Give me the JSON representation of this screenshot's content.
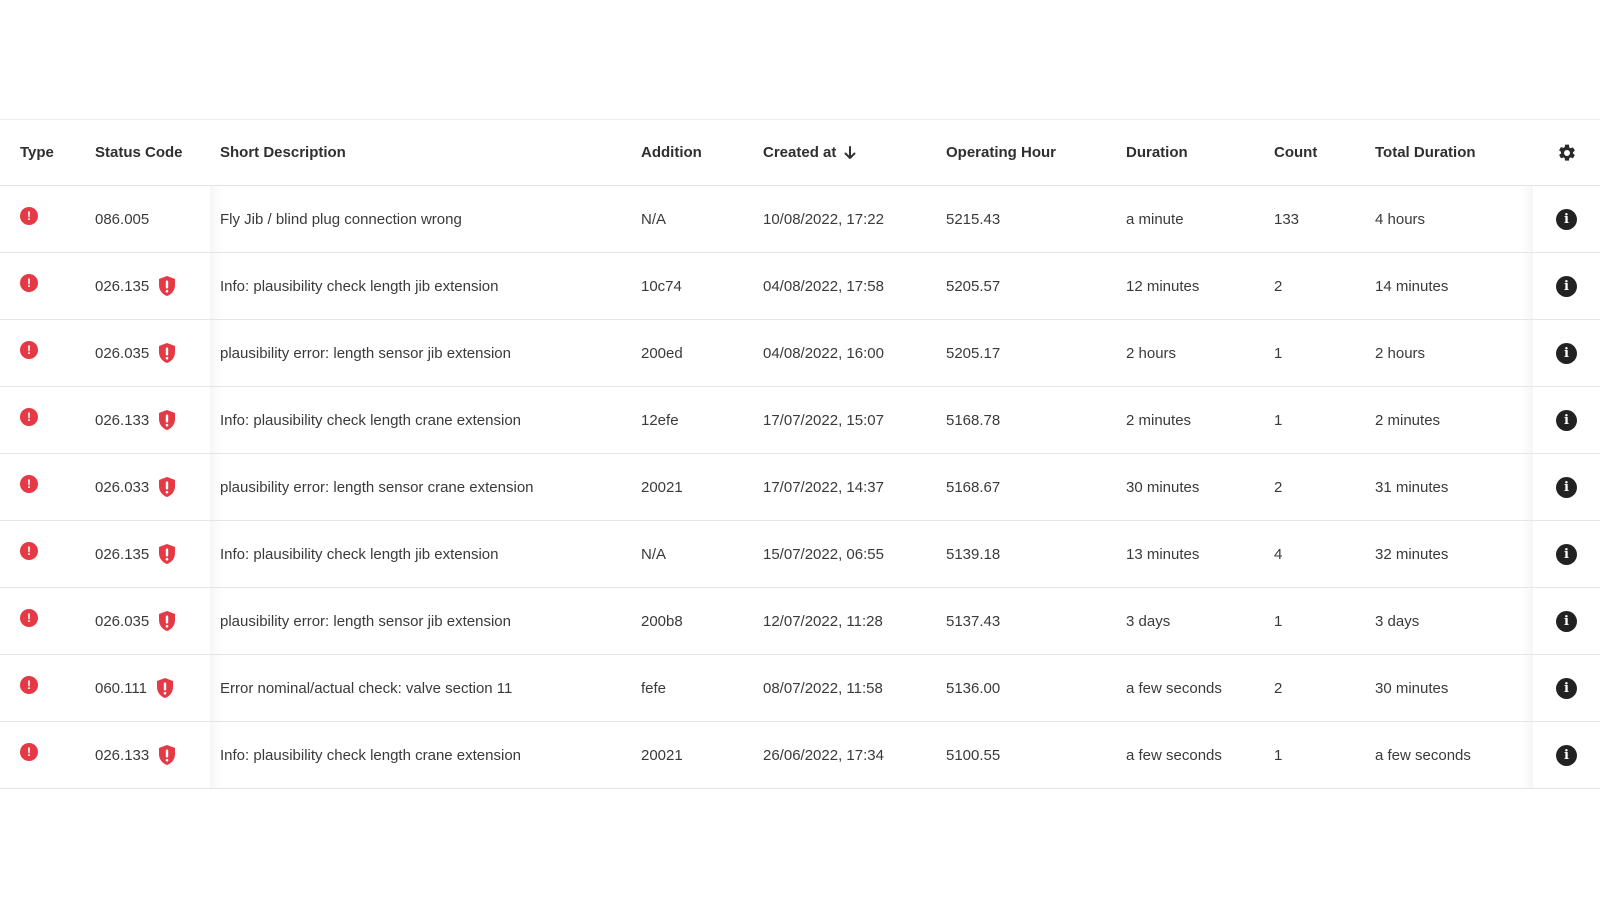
{
  "table": {
    "headers": {
      "type": "Type",
      "status_code": "Status Code",
      "short_description": "Short Description",
      "addition": "Addition",
      "created_at": "Created at",
      "operating_hour": "Operating Hour",
      "duration": "Duration",
      "count": "Count",
      "total_duration": "Total Duration"
    },
    "sort": {
      "column": "created_at",
      "direction": "descending",
      "icon": "arrow-down-icon"
    },
    "settings_icon": "gear-icon",
    "colors": {
      "error": "#e53946",
      "info_icon": "#222222",
      "text": "#3a3a3a"
    },
    "rows": [
      {
        "type_icon": "error-icon",
        "status_code": "086.005",
        "shield": false,
        "short_description": "Fly Jib / blind plug connection wrong",
        "addition": "N/A",
        "created_at": "10/08/2022, 17:22",
        "operating_hour": "5215.43",
        "duration": "a minute",
        "count": "133",
        "total_duration": "4 hours"
      },
      {
        "type_icon": "error-icon",
        "status_code": "026.135",
        "shield": true,
        "short_description": "Info: plausibility check length jib extension",
        "addition": "10c74",
        "created_at": "04/08/2022, 17:58",
        "operating_hour": "5205.57",
        "duration": "12 minutes",
        "count": "2",
        "total_duration": "14 minutes"
      },
      {
        "type_icon": "error-icon",
        "status_code": "026.035",
        "shield": true,
        "short_description": "plausibility error: length sensor jib extension",
        "addition": "200ed",
        "created_at": "04/08/2022, 16:00",
        "operating_hour": "5205.17",
        "duration": "2 hours",
        "count": "1",
        "total_duration": "2 hours"
      },
      {
        "type_icon": "error-icon",
        "status_code": "026.133",
        "shield": true,
        "short_description": "Info: plausibility check length crane extension",
        "addition": "12efe",
        "created_at": "17/07/2022, 15:07",
        "operating_hour": "5168.78",
        "duration": "2 minutes",
        "count": "1",
        "total_duration": "2 minutes"
      },
      {
        "type_icon": "error-icon",
        "status_code": "026.033",
        "shield": true,
        "short_description": "plausibility error: length sensor crane extension",
        "addition": "20021",
        "created_at": "17/07/2022, 14:37",
        "operating_hour": "5168.67",
        "duration": "30 minutes",
        "count": "2",
        "total_duration": "31 minutes"
      },
      {
        "type_icon": "error-icon",
        "status_code": "026.135",
        "shield": true,
        "short_description": "Info: plausibility check length jib extension",
        "addition": "N/A",
        "created_at": "15/07/2022, 06:55",
        "operating_hour": "5139.18",
        "duration": "13 minutes",
        "count": "4",
        "total_duration": "32 minutes"
      },
      {
        "type_icon": "error-icon",
        "status_code": "026.035",
        "shield": true,
        "short_description": "plausibility error: length sensor jib extension",
        "addition": "200b8",
        "created_at": "12/07/2022, 11:28",
        "operating_hour": "5137.43",
        "duration": "3 days",
        "count": "1",
        "total_duration": "3 days"
      },
      {
        "type_icon": "error-icon",
        "status_code": "060.111",
        "shield": true,
        "short_description": "Error nominal/actual check: valve section 11",
        "addition": "fefe",
        "created_at": "08/07/2022, 11:58",
        "operating_hour": "5136.00",
        "duration": "a few seconds",
        "count": "2",
        "total_duration": "30 minutes"
      },
      {
        "type_icon": "error-icon",
        "status_code": "026.133",
        "shield": true,
        "short_description": "Info: plausibility check length crane extension",
        "addition": "20021",
        "created_at": "26/06/2022, 17:34",
        "operating_hour": "5100.55",
        "duration": "a few seconds",
        "count": "1",
        "total_duration": "a few seconds"
      }
    ]
  }
}
